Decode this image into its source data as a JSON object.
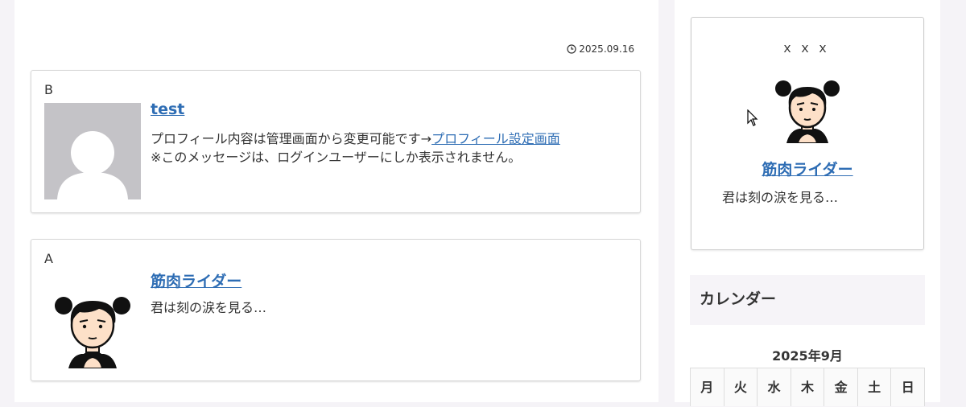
{
  "post": {
    "date": "2025.09.16",
    "date_icon": "clock-icon"
  },
  "author_boxes": [
    {
      "label": "B",
      "name": "test",
      "avatar": "default-avatar-icon",
      "desc_text": "プロフィール内容は管理画面から変更可能です→",
      "desc_link": "プロフィール設定画面",
      "desc_note": "※このメッセージは、ログインユーザーにしか表示されません。"
    },
    {
      "label": "A",
      "name": "筋肉ライダー",
      "avatar": "character-avatar",
      "desc_text": "君は刻の涙を見る…"
    }
  ],
  "sidebar": {
    "profile": {
      "title": "ｘｘｘ",
      "name": "筋肉ライダー",
      "desc": "君は刻の涙を見る…"
    },
    "calendar": {
      "widget_title": "カレンダー",
      "caption": "2025年9月",
      "weekdays": [
        "月",
        "火",
        "水",
        "木",
        "金",
        "土",
        "日"
      ]
    }
  },
  "colors": {
    "link": "#2e6db4",
    "page_bg": "#f5f3f7"
  }
}
